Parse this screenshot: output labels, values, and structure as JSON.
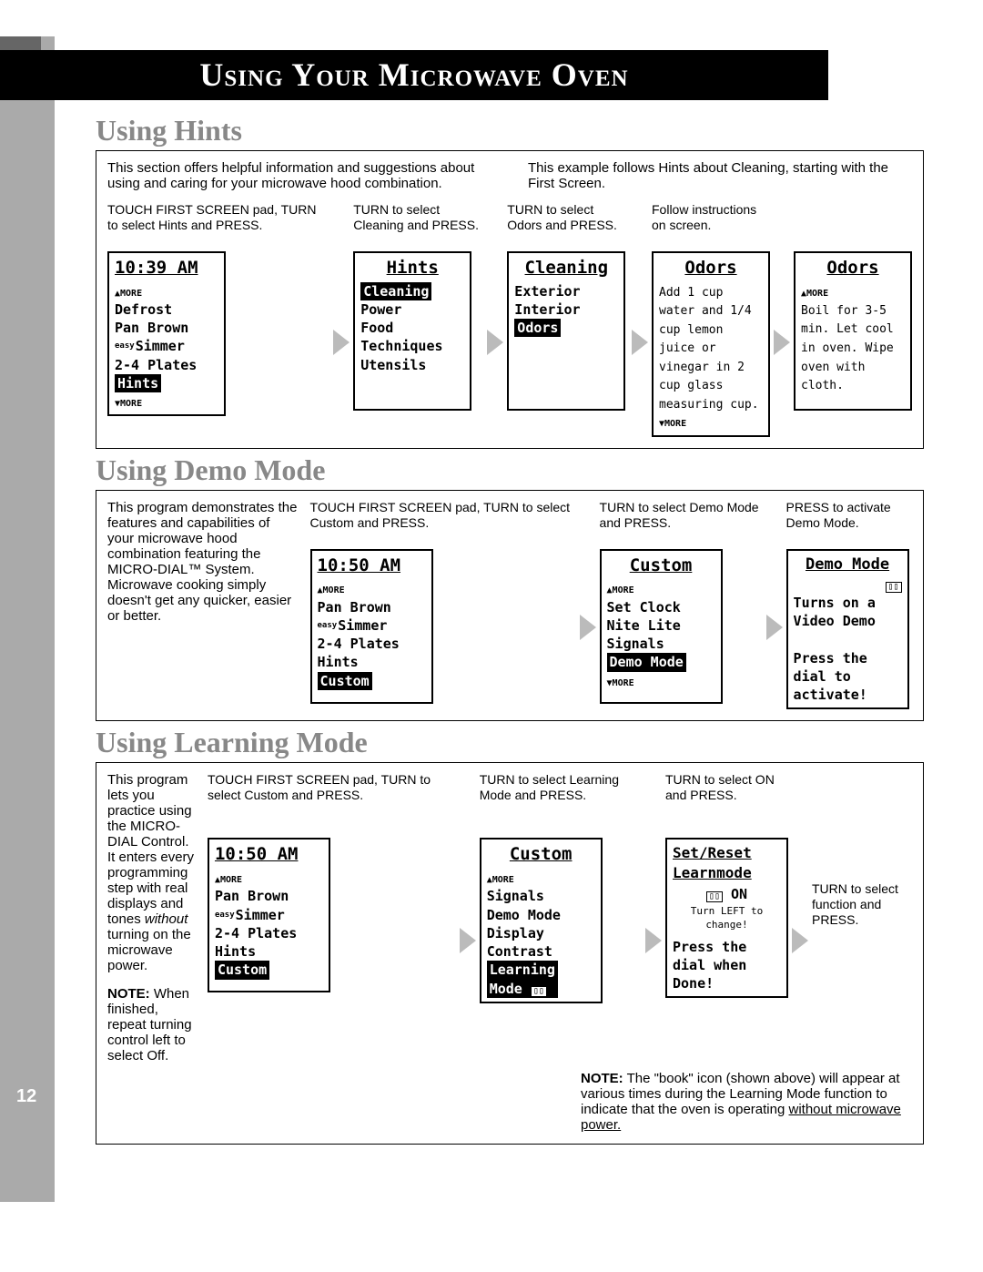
{
  "banner": "Using Your Microwave Oven",
  "page_num": "12",
  "hints": {
    "title": "Using Hints",
    "intro_left": "This section offers helpful information and suggestions about using and caring for your microwave hood combination.",
    "intro_right": "This example follows Hints about Cleaning, starting with the First Screen.",
    "steps": [
      {
        "caption": "TOUCH FIRST SCREEN pad, TURN to select Hints and PRESS.",
        "lcd": {
          "title_left": "10:39 AM",
          "more_top": "▲MORE",
          "items": [
            "Defrost",
            "Pan Brown",
            "easy Simmer",
            "2-4 Plates"
          ],
          "sel": "Hints",
          "more_bot": "▼MORE"
        }
      },
      {
        "caption": "TURN to select Cleaning and PRESS.",
        "lcd": {
          "title": "Hints",
          "sel": "Cleaning",
          "items": [
            "Power",
            "Food",
            "Techniques",
            "Utensils"
          ]
        }
      },
      {
        "caption": "TURN to select Odors and PRESS.",
        "lcd": {
          "title": "Cleaning",
          "items": [
            "Exterior",
            "Interior"
          ],
          "sel": "Odors"
        }
      },
      {
        "caption": "Follow instructions on screen.",
        "lcd": {
          "title": "Odors",
          "body": "Add 1 cup water and 1/4 cup lemon juice or vinegar in 2 cup glass measuring cup.",
          "more_bot": "▼MORE"
        }
      },
      {
        "caption": "",
        "lcd": {
          "title": "Odors",
          "more_top": "▲MORE",
          "body": "Boil for 3-5 min. Let cool in oven. Wipe oven with cloth."
        }
      }
    ]
  },
  "demo": {
    "title": "Using Demo Mode",
    "intro": "This program demonstrates the features and capabilities of your microwave hood combination featuring the MICRO-DIAL™ System. Microwave cooking simply doesn't get any quicker, easier or better.",
    "steps": [
      {
        "caption": "TOUCH FIRST SCREEN pad, TURN to select Custom and PRESS.",
        "lcd": {
          "title_left": "10:50 AM",
          "more_top": "▲MORE",
          "items": [
            "Pan Brown",
            "easy Simmer",
            "2-4 Plates",
            "Hints"
          ],
          "sel": "Custom"
        }
      },
      {
        "caption": "TURN to select Demo Mode and PRESS.",
        "lcd": {
          "title": "Custom",
          "more_top": "▲MORE",
          "items": [
            "Set Clock",
            "Nite Lite",
            "Signals"
          ],
          "sel": "Demo Mode",
          "more_bot": "▼MORE"
        }
      },
      {
        "caption": "PRESS to activate Demo Mode.",
        "lcd": {
          "title_u": "Demo Mode",
          "book": true,
          "lines": [
            "Turns on a",
            "Video Demo",
            "",
            "Press the",
            "dial to",
            "activate!"
          ]
        }
      }
    ]
  },
  "learning": {
    "title": "Using Learning Mode",
    "intro": "This program lets you practice using the MICRO-DIAL Control. It enters every programming step with real displays and tones ",
    "intro_em": "without",
    "intro2": " turning on the microwave power.",
    "note_prefix": "NOTE:",
    "note_body": " When finished, repeat turning control left to select Off.",
    "steps": [
      {
        "caption": "TOUCH FIRST SCREEN pad, TURN to select Custom and PRESS.",
        "lcd": {
          "title_left": "10:50 AM",
          "more_top": "▲MORE",
          "items": [
            "Pan Brown",
            "easy Simmer",
            "2-4 Plates",
            "Hints"
          ],
          "sel": "Custom"
        }
      },
      {
        "caption": "TURN to select Learning Mode and PRESS.",
        "lcd": {
          "title": "Custom",
          "more_top": "▲MORE",
          "items": [
            "Signals",
            "Demo Mode",
            "Display"
          ],
          "extra": "  Contrast",
          "sel": "Learning",
          "sel_suffix": "Mode",
          "book_inline": true
        }
      },
      {
        "caption": "TURN to select ON and PRESS.",
        "lcd": {
          "two_title": [
            "Set/Reset",
            "Learnmode"
          ],
          "book": true,
          "on": "ON",
          "sub": "Turn LEFT to change!",
          "foot": [
            "Press the",
            "dial when",
            "Done!"
          ]
        }
      },
      {
        "caption": "TURN to select function and PRESS."
      }
    ],
    "bottom_note_prefix": "NOTE:",
    "bottom_note": " The \"book\" icon (shown above) will appear at various times during the Learning Mode function to indicate that the oven is operating ",
    "bottom_note_u": "without microwave power."
  }
}
